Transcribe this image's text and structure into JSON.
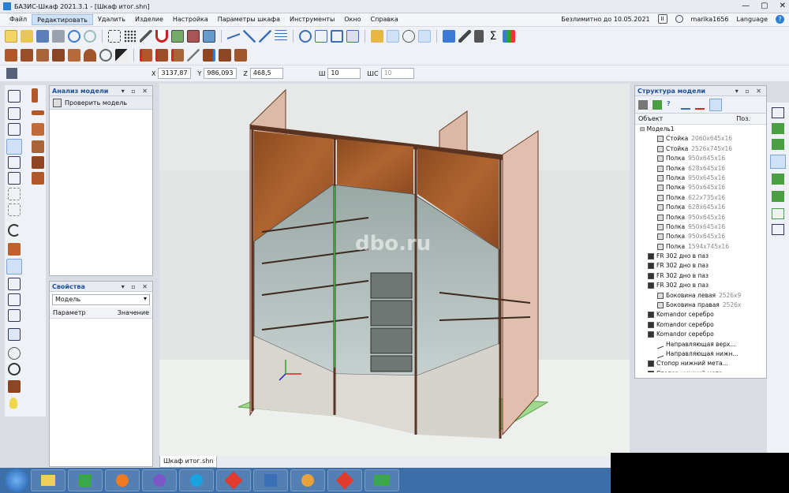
{
  "window": {
    "title": "БАЗИС-Шкаф 2021.3.1 - [Шкаф итог.shn]",
    "buttons": [
      "—",
      "▢",
      "✕"
    ]
  },
  "menu": {
    "items": [
      "Файл",
      "Редактировать",
      "Удалить",
      "Изделие",
      "Настройка",
      "Параметры шкафа",
      "Инструменты",
      "Окно",
      "Справка"
    ],
    "license": "Безлимитно до 10.05.2021",
    "user": "marika1656",
    "language": "Language"
  },
  "coords": {
    "x_label": "X",
    "x": "3137,87",
    "y_label": "Y",
    "y": "986,093",
    "z_label": "Z",
    "z": "468,5",
    "sh_label": "Ш",
    "sh": "10",
    "shs_label": "ШС",
    "shs": "10"
  },
  "analysis_panel": {
    "title": "Анализ модели",
    "check_button": "Проверить модель"
  },
  "props_panel": {
    "title": "Свойства",
    "selected": "Модель",
    "col_param": "Параметр",
    "col_value": "Значение"
  },
  "structure_panel": {
    "title": "Структура модели",
    "col_object": "Объект",
    "col_pos": "Поз.",
    "root": "Модель1",
    "items": [
      {
        "name": "Стойка",
        "dim": "2060x645x16",
        "icon": "panel"
      },
      {
        "name": "Стойка",
        "dim": "2526x745x16",
        "icon": "panel"
      },
      {
        "name": "Полка",
        "dim": "950x645x16",
        "icon": "panel"
      },
      {
        "name": "Полка",
        "dim": "628x645x16",
        "icon": "panel"
      },
      {
        "name": "Полка",
        "dim": "950x645x16",
        "icon": "panel"
      },
      {
        "name": "Полка",
        "dim": "950x645x16",
        "icon": "panel"
      },
      {
        "name": "Полка",
        "dim": "622x735x16",
        "icon": "panel"
      },
      {
        "name": "Полка",
        "dim": "628x645x16",
        "icon": "panel"
      },
      {
        "name": "Полка",
        "dim": "950x645x16",
        "icon": "panel"
      },
      {
        "name": "Полка",
        "dim": "950x645x16",
        "icon": "panel"
      },
      {
        "name": "Полка",
        "dim": "950x645x16",
        "icon": "panel"
      },
      {
        "name": "Полка",
        "dim": "1594x745x16",
        "icon": "panel"
      },
      {
        "name": "FR 302 дно в паз",
        "dim": "",
        "icon": "box"
      },
      {
        "name": "FR 302 дно в паз",
        "dim": "",
        "icon": "box"
      },
      {
        "name": "FR 302 дно в паз",
        "dim": "",
        "icon": "box"
      },
      {
        "name": "FR 302 дно в паз",
        "dim": "",
        "icon": "box"
      },
      {
        "name": "Боковина левая",
        "dim": "2526x9",
        "icon": "panel"
      },
      {
        "name": "Боковина правая",
        "dim": "2526x",
        "icon": "panel"
      },
      {
        "name": "Komandor серебро",
        "dim": "",
        "icon": "box"
      },
      {
        "name": "Komandor серебро",
        "dim": "",
        "icon": "box"
      },
      {
        "name": "Komandor серебро",
        "dim": "",
        "icon": "box"
      },
      {
        "name": "Направляющая верх...",
        "dim": "",
        "icon": "line"
      },
      {
        "name": "Направляющая нижн...",
        "dim": "",
        "icon": "line"
      },
      {
        "name": "Стопор нижний мета...",
        "dim": "",
        "icon": "box"
      },
      {
        "name": "Стопор нижний мета...",
        "dim": "",
        "icon": "box"
      }
    ]
  },
  "viewport": {
    "watermark": "dbo.ru"
  },
  "tabs": {
    "document": "Шкаф итог.shn"
  },
  "taskbar": {
    "apps": [
      "explorer",
      "basis",
      "firefox",
      "viber",
      "skype",
      "anydesk",
      "paint",
      "chrome",
      "anydesk2",
      "basis2"
    ]
  }
}
